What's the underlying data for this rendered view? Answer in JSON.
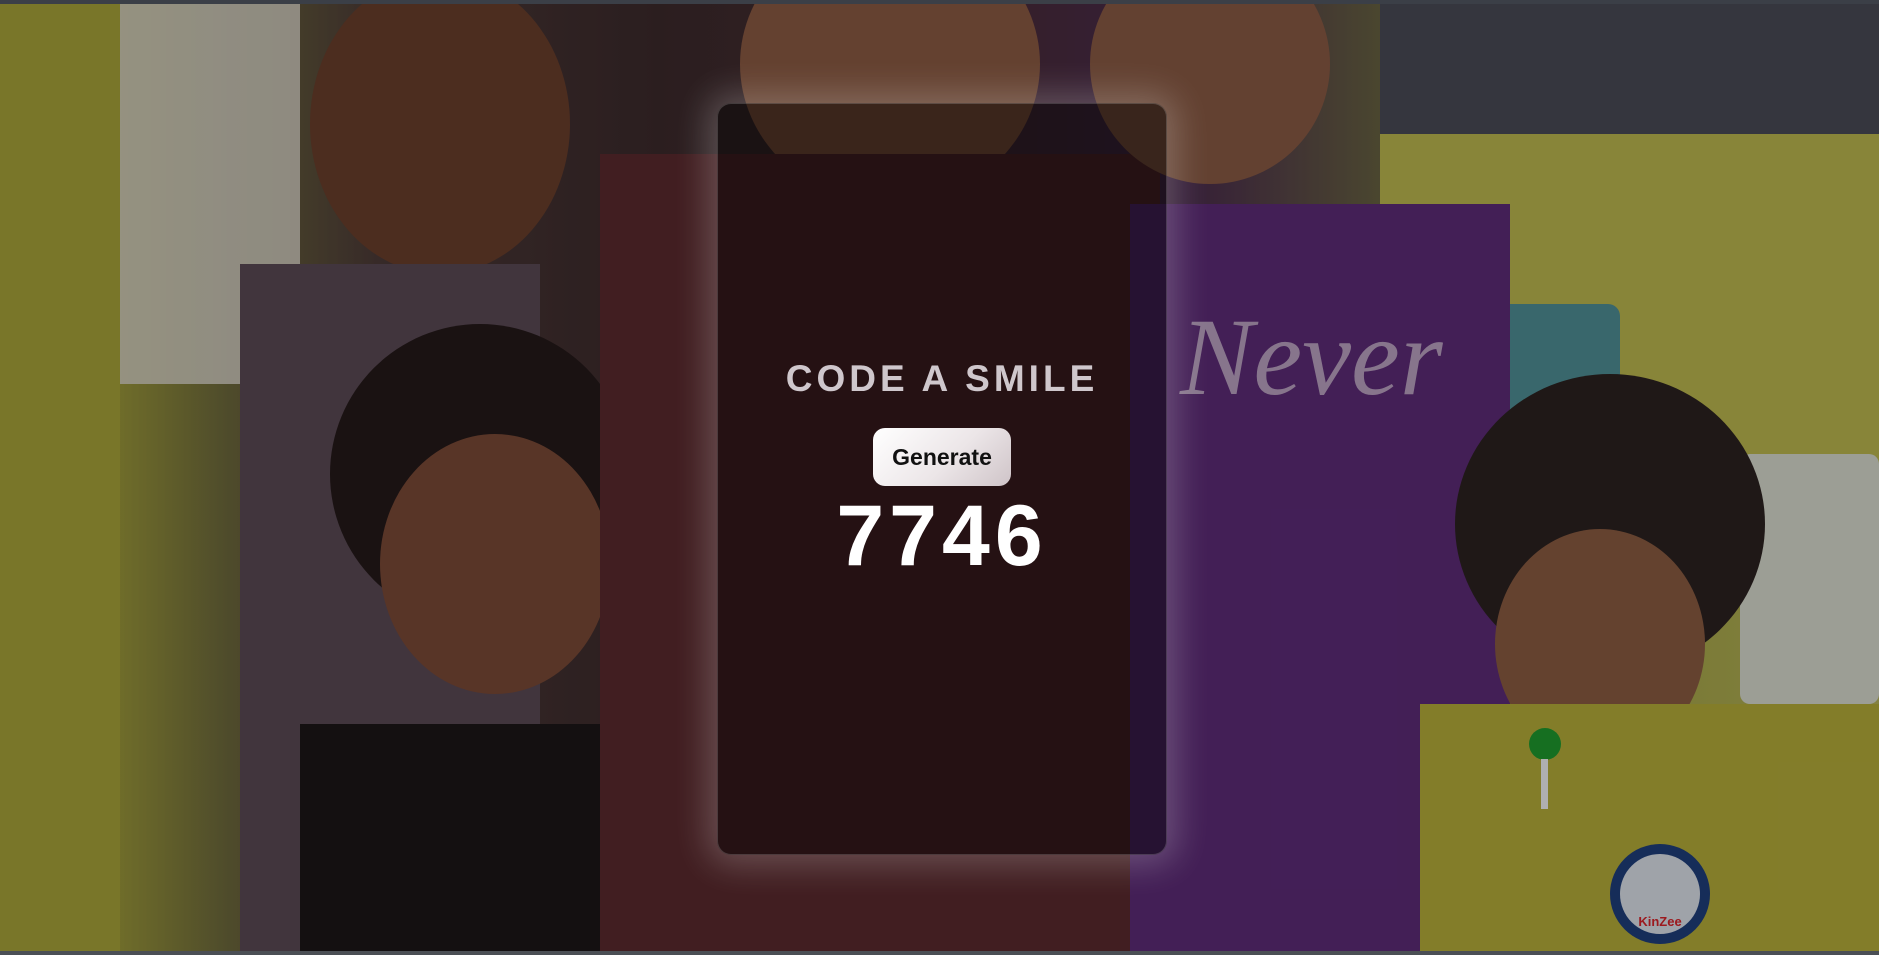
{
  "app": {
    "title": "CODE A SMILE",
    "generate_label": "Generate",
    "generated_number": "7746"
  },
  "background": {
    "logo_text": "KinZee"
  }
}
